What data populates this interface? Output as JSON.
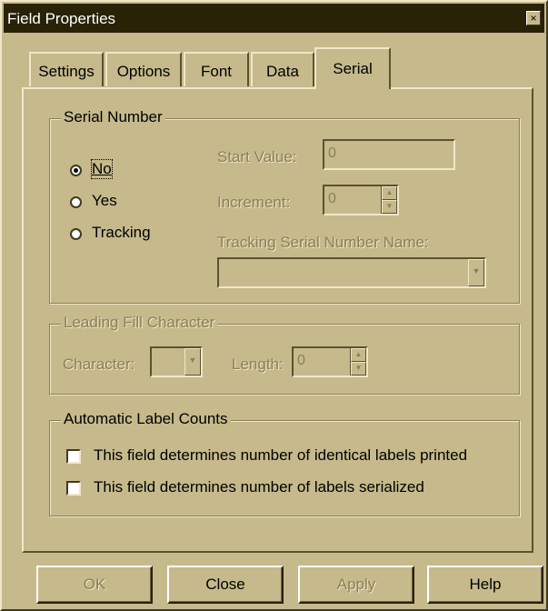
{
  "window": {
    "title": "Field Properties",
    "close_glyph": "×"
  },
  "tabs": [
    {
      "label": "Settings"
    },
    {
      "label": "Options"
    },
    {
      "label": "Font"
    },
    {
      "label": "Data"
    },
    {
      "label": "Serial",
      "active": true
    }
  ],
  "serial_number": {
    "legend": "Serial Number",
    "options": [
      {
        "label": "No",
        "checked": true
      },
      {
        "label": "Yes",
        "checked": false
      },
      {
        "label": "Tracking",
        "checked": false
      }
    ],
    "start_value_label": "Start Value:",
    "start_value": "0",
    "increment_label": "Increment:",
    "increment_value": "0",
    "tracking_name_label": "Tracking Serial Number Name:",
    "tracking_name_value": ""
  },
  "leading_fill": {
    "legend": "Leading Fill Character",
    "character_label": "Character:",
    "character_value": "",
    "length_label": "Length:",
    "length_value": "0"
  },
  "label_counts": {
    "legend": "Automatic Label Counts",
    "checkboxes": [
      {
        "label": "This field determines number of  identical labels printed",
        "checked": false
      },
      {
        "label": "This field determines number of  labels serialized",
        "checked": false
      }
    ]
  },
  "buttons": {
    "ok": "OK",
    "close": "Close",
    "apply": "Apply",
    "help": "Help"
  },
  "colors": {
    "face": "#c6b98b",
    "titlebar": "#2a2206",
    "disabled_text": "#8a7f58"
  }
}
